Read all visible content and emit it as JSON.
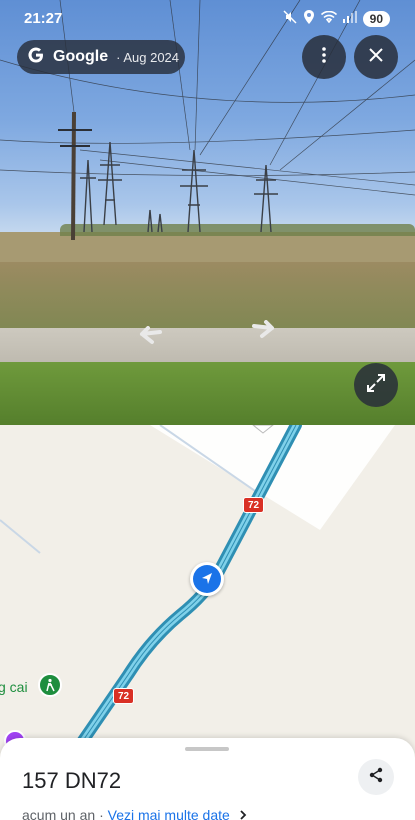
{
  "status_bar": {
    "time": "21:27",
    "battery": "90"
  },
  "street_view": {
    "brand": "Google",
    "date_separator": "·",
    "capture_date": "Aug 2024"
  },
  "map": {
    "poi_label": "g cai",
    "route_badge_1": "72",
    "route_badge_2": "72"
  },
  "sheet": {
    "title": "157 DN72",
    "age": "acum un an",
    "separator": "·",
    "more_dates_link": "Vezi mai multe date"
  },
  "icons": {
    "more": "more-vert-icon",
    "close": "close-icon",
    "expand": "expand-icon",
    "share": "share-icon",
    "location": "navigation-arrow-icon"
  },
  "colors": {
    "accent": "#1a73e8",
    "route": "#4fb3d9",
    "route_badge": "#d93025",
    "poi_green": "#1e8e3e"
  }
}
